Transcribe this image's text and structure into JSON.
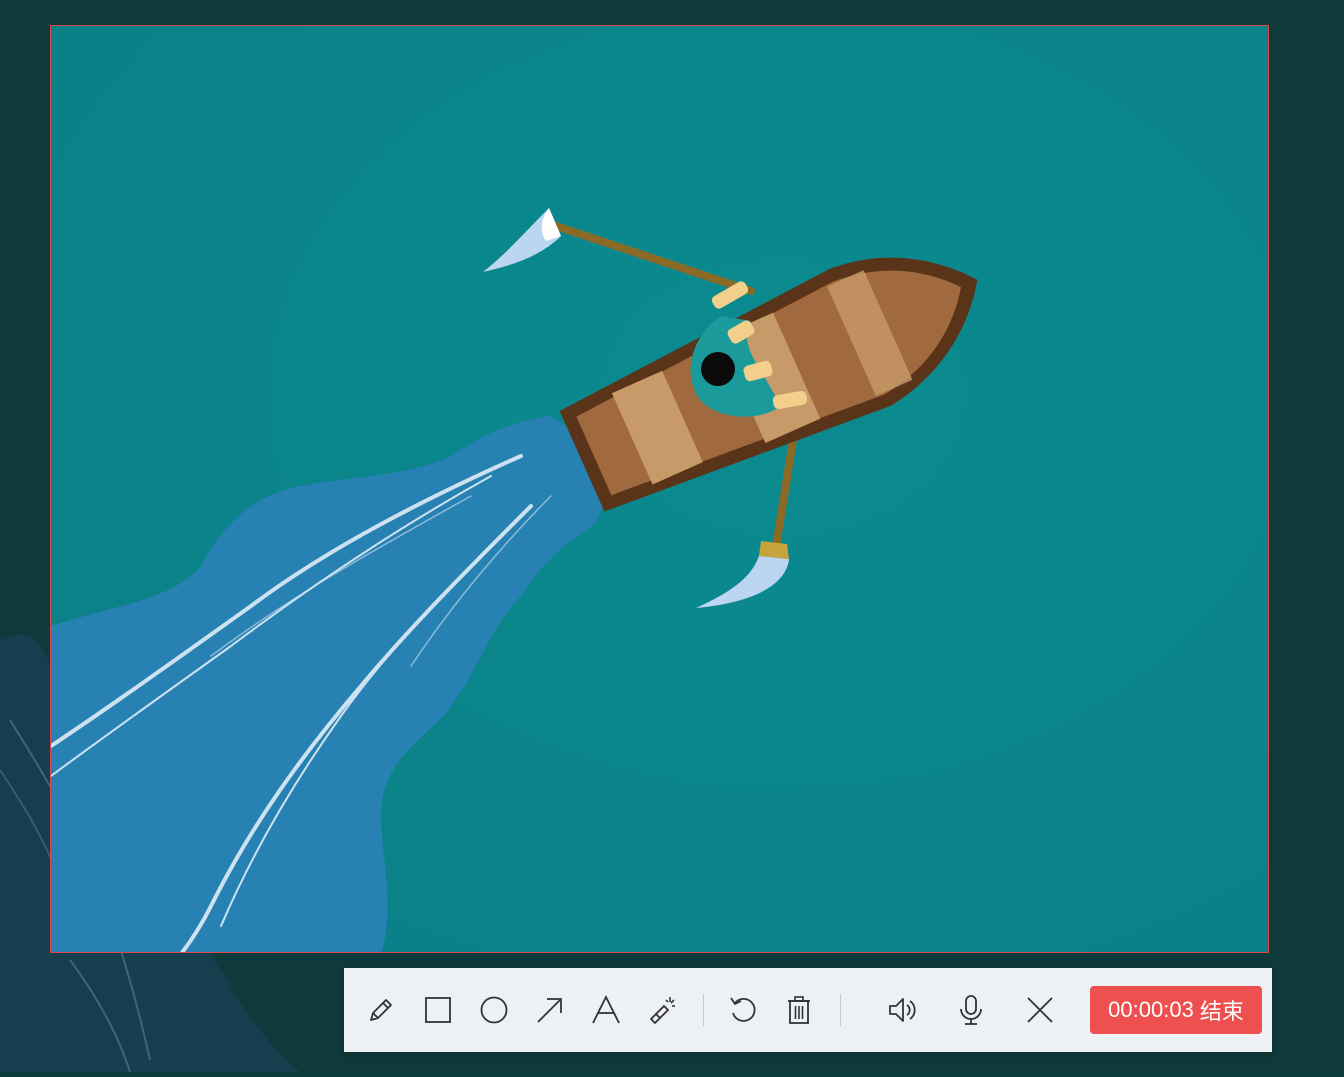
{
  "recorder": {
    "timer": "00:00:03",
    "end_label": "结束"
  },
  "tools": [
    {
      "name": "pencil-tool",
      "icon": "pencil-icon"
    },
    {
      "name": "rectangle-tool",
      "icon": "rectangle-icon"
    },
    {
      "name": "ellipse-tool",
      "icon": "circle-icon"
    },
    {
      "name": "arrow-tool",
      "icon": "arrow-icon"
    },
    {
      "name": "text-tool",
      "icon": "text-icon"
    },
    {
      "name": "highlighter-tool",
      "icon": "magic-wand-icon"
    },
    {
      "name": "undo-button",
      "icon": "undo-icon"
    },
    {
      "name": "delete-button",
      "icon": "trash-icon"
    },
    {
      "name": "speaker-toggle",
      "icon": "speaker-icon"
    },
    {
      "name": "microphone-toggle",
      "icon": "microphone-icon"
    },
    {
      "name": "close-button",
      "icon": "close-icon"
    }
  ],
  "colors": {
    "frame_border": "#e0454a",
    "end_button": "#ee4f4f",
    "toolbar_bg": "#eef1f4",
    "water": "#0b8b8e",
    "wake": "#2a82b4",
    "boat": "#a06a3e"
  }
}
